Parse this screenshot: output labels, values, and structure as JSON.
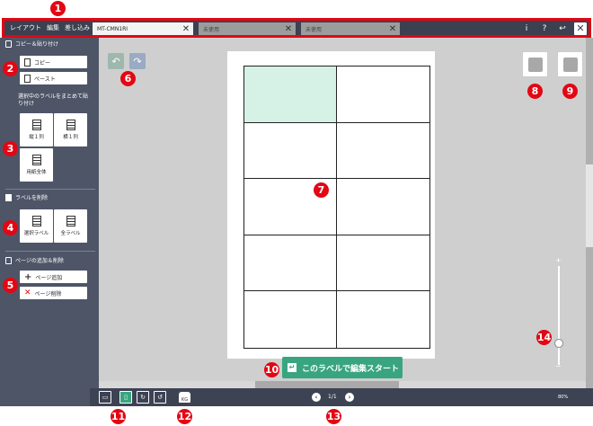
{
  "app": {
    "menu": [
      "レイアウト",
      "編集",
      "差し込み"
    ],
    "tabs": [
      {
        "label": "MT-CMN1RI"
      },
      {
        "label": "未使用"
      },
      {
        "label": "未使用"
      }
    ],
    "top_icons": [
      "info-icon",
      "help-icon",
      "undo-back-icon",
      "close-icon"
    ],
    "top_icon_glyphs": {
      "info": "i",
      "help": "?",
      "back": "↩",
      "close": "✕"
    }
  },
  "sidebar": {
    "copy_section": {
      "title": "コピー＆貼り付け",
      "copy": "コピー",
      "paste": "ペースト"
    },
    "bulk_section": {
      "title": "選択中のラベルをまとめて貼り付け",
      "row": "縦１列",
      "col": "横１列",
      "all": "用紙全体"
    },
    "delete_section": {
      "title": "ラベルを削除",
      "selected": "選択ラベル",
      "all": "全ラベル"
    },
    "page_section": {
      "title": "ページの追加＆削除",
      "add": "ページ追加",
      "delete": "ページ削除"
    }
  },
  "canvas": {
    "start_button": "このラベルで編集スタート",
    "label_cells": 10,
    "active_cell": 0
  },
  "bottom": {
    "page_text": "1/1",
    "zoom": "80%",
    "kg_label": "KG"
  },
  "callouts": [
    "1",
    "2",
    "3",
    "4",
    "5",
    "6",
    "7",
    "8",
    "9",
    "10",
    "11",
    "12",
    "13",
    "14"
  ],
  "colors": {
    "accent": "#39a580",
    "callout": "#e30613",
    "sidebar": "#4e5567",
    "topbar": "#3b4150"
  }
}
